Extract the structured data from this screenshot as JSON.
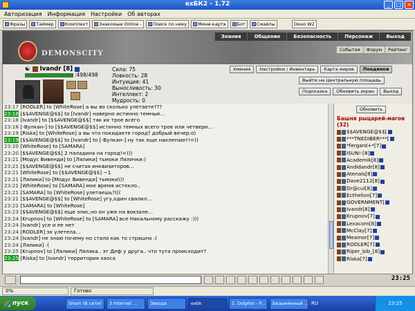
{
  "window": {
    "title": "exБК2 - 1.72"
  },
  "menu": [
    "Авторизация",
    "Информация",
    "Настройки",
    "Об авторах"
  ],
  "toolbar": [
    "Фразы",
    "Таймер",
    "Комплект",
    "Знакомые Online -",
    "Поиск по нику",
    "Мини-карта",
    "Бот",
    "Смайлы",
    "Окно W2"
  ],
  "game": {
    "brand": "DEMONSCITY",
    "topnav": [
      "Знания",
      "Общение",
      "Безопасность",
      "Персонаж",
      "Выход"
    ],
    "subnav": [
      "События",
      "Форум",
      "Рейтинг"
    ],
    "character": {
      "name": "Ivandr [8]",
      "hp_text": ":498/498",
      "hp_fraction": 1.0,
      "stats": [
        "Сила: 75",
        "Ловкость: 28",
        "Интуиция: 41",
        "Выносливость: 30",
        "Интеллект: 2",
        "Мудрость: 0"
      ]
    },
    "buttons_row1": [
      "Умения",
      "Настройки / Инвентарь",
      "Карта миров",
      "Поединки"
    ],
    "buttons_row2": [
      "Выйти на Центральную площадь"
    ],
    "buttons_row3": [
      "Подсказка",
      "Обновить экран",
      "Выход"
    ],
    "side": {
      "refresh": "Обновить",
      "tower_title": "Башня рыцарей-магов (32)",
      "users": [
        "$$AVENGE@$$[",
        "***TNEDIBER***[",
        "*fergard+*[7]",
        "ISUN!-[8]",
        "Academik[8]",
        "Andidandr[8]",
        "Atenais[8]",
        "Dave2112[8]",
        "Dr@cul[8]",
        "Ecthelion[7]",
        "GOVERNMENT[",
        "Ivandr[8]",
        "Krupnov[7]",
        "Lexacom[8]",
        "McClay[7]",
        "Meamor[7]",
        "RODLER[7]",
        "Riper_bib_[8]",
        "Riska[7]"
      ]
    }
  },
  "chat": [
    {
      "time": "23:17",
      "text": "[RODLER] to [WhiteRose] а вы во сколько улетаете???",
      "hl": false
    },
    {
      "time": "23:18",
      "text": "[$$AVENGE@$$] to [Ivandr] наверно истинно темные...",
      "hl": true
    },
    {
      "time": "23:18",
      "text": "[Ivandr] to [$$AVENGE@$$] так их трое всего",
      "hl": false
    },
    {
      "time": "23:18",
      "text": "[-Вулкан-] to [$$AVENGE@$$] истинно темных всего трое или четвери...",
      "hl": false
    },
    {
      "time": "23:19",
      "text": "[Riska] to [WhiteRose] а вы что покидаете город? добрый вечер:о)",
      "hl": false
    },
    {
      "time": "23:19",
      "text": "[$$AVENGE@$$] to [Ivandr] to [-Вулкан-] ну так еще наклепают!=))",
      "hl": true
    },
    {
      "time": "23:20",
      "text": "[WhiteRose] to [SAMARA]",
      "hl": false
    },
    {
      "time": "23:20",
      "text": "[$$AVENGE@$$] 2 паладина на город!=)))",
      "hl": false
    },
    {
      "time": "23:21",
      "text": "[Модус Вивенди] to [Лялики] тьмоки Лялички:)",
      "hl": false
    },
    {
      "time": "23:21",
      "text": "[$$AVENGE@$$] не считая инквизиторов...",
      "hl": false
    },
    {
      "time": "23:21",
      "text": "[WhiteRose] to [$$AVENGE@$$] ~1",
      "hl": false
    },
    {
      "time": "23:21",
      "text": "[Лялики] to [Модус Вивенди] тьмоки)))",
      "hl": false
    },
    {
      "time": "23:21",
      "text": "[WhiteRose] to [SAMARA] мое время истекло..",
      "hl": false
    },
    {
      "time": "23:21",
      "text": "[SAMARA] to [WhiteRose] улетаешь?(((",
      "hl": false
    },
    {
      "time": "23:21",
      "text": "[$$AVENGE@$$] to [WhiteRose] угу,один свалил...",
      "hl": false
    },
    {
      "time": "23:22",
      "text": "[SAMARA] to [WhiteRose]",
      "hl": false
    },
    {
      "time": "23:23",
      "text": "[$$AVENGE@$$] еще элис,но он уже на вокзале...",
      "hl": false
    },
    {
      "time": "23:24",
      "text": "[Krupnov] to [WhiteRose] to [SAMARA] все Накальному расскажу :)))",
      "hl": false
    },
    {
      "time": "23:24",
      "text": "[Ivandr] усе и ее нет",
      "hl": false
    },
    {
      "time": "23:24",
      "text": "[RODLER] эх улетела...",
      "hl": false
    },
    {
      "time": "23:24",
      "text": "[Ivandr] не знаю почему но стало как то страшно :(",
      "hl": false
    },
    {
      "time": "23:24",
      "text": "[Лялики] :(",
      "hl": false
    },
    {
      "time": "23:25",
      "text": "[Krupnov] to [Лялики] Лялякa.. эт Деф у друга.. что тута происходит?",
      "hl": false
    },
    {
      "time": "23:25",
      "text": "[Riska] to [Ivandr] территория хаоса",
      "hl": true
    }
  ],
  "clock": "23:25",
  "statusbar": [
    "0%",
    "Готово"
  ],
  "taskbar": {
    "start": "пуск",
    "tasks": [
      "Sham (В сети)",
      "3 Internet ...",
      "Звезда",
      "exbk",
      "1. Dolphin - P...",
      "Безымянный ..."
    ],
    "lang": "RU",
    "tray": "23:25"
  },
  "colors": {
    "hl_time_bg": "#1c9c1c",
    "tower_title": "#a00000"
  }
}
